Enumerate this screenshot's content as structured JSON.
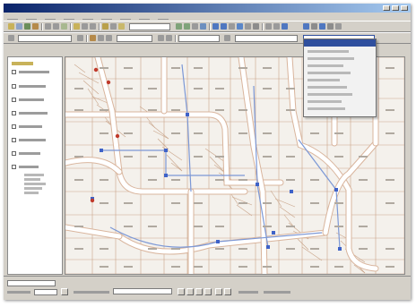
{
  "window": {
    "title": ""
  },
  "menu": {
    "items": [
      "",
      "",
      "",
      "",
      "",
      "",
      "",
      "",
      ""
    ]
  },
  "toolbar": {
    "scale_value": "",
    "layer_value": "",
    "search_value": ""
  },
  "layers_panel": {
    "items": [
      "",
      "",
      "",
      "",
      "",
      "",
      "",
      ""
    ]
  },
  "dropdown": {
    "selected": "",
    "options": [
      "",
      "",
      "",
      "",
      "",
      "",
      "",
      "",
      ""
    ]
  },
  "statusbar": {
    "coordinates": "",
    "zoom": ""
  },
  "colors": {
    "titlebar_start": "#0a246a",
    "titlebar_end": "#a6caf0",
    "parcel_line": "#c9a489",
    "street_fill": "#ffffff",
    "street_edge": "#d9b59d",
    "utility_line": "#7c98d6",
    "utility_node": "#3e62c8",
    "feature_red": "#c0392b",
    "panel_bg": "#d4d0c8"
  }
}
